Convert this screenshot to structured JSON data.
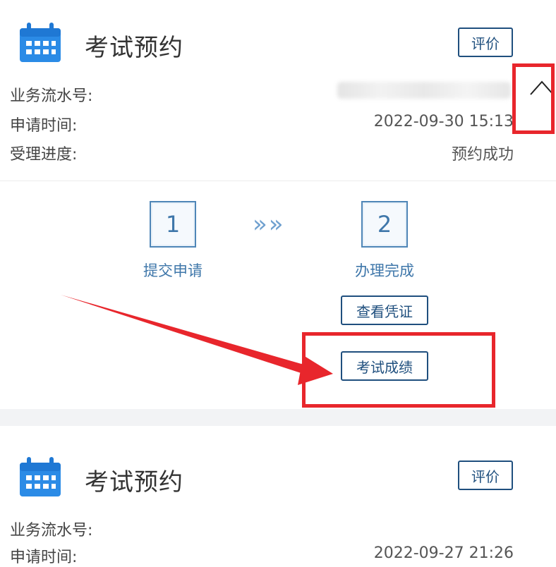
{
  "cards": [
    {
      "title": "考试预约",
      "rate_label": "评价",
      "fields": [
        {
          "label": "业务流水号:",
          "value": ""
        },
        {
          "label": "申请时间:",
          "value": "2022-09-30 15:13"
        },
        {
          "label": "受理进度:",
          "value": "预约成功"
        }
      ],
      "steps": [
        {
          "number": "1",
          "label": "提交申请"
        },
        {
          "number": "2",
          "label": "办理完成"
        }
      ],
      "step_separator": "»»",
      "actions": {
        "view_certificate": "查看凭证",
        "exam_score": "考试成绩"
      }
    },
    {
      "title": "考试预约",
      "rate_label": "评价",
      "fields": [
        {
          "label": "业务流水号:",
          "value": ""
        },
        {
          "label": "申请时间:",
          "value": "2022-09-27 21:26"
        }
      ]
    }
  ],
  "colors": {
    "primary": "#1f4f7e",
    "step_blue": "#3f77aa",
    "annotation_red": "#e8262c",
    "calendar_blue": "#2b8be6"
  },
  "icons": {
    "calendar": "calendar-icon",
    "chevron": "chevron-up-icon",
    "step_arrows": "double-chevron-right-icon"
  }
}
